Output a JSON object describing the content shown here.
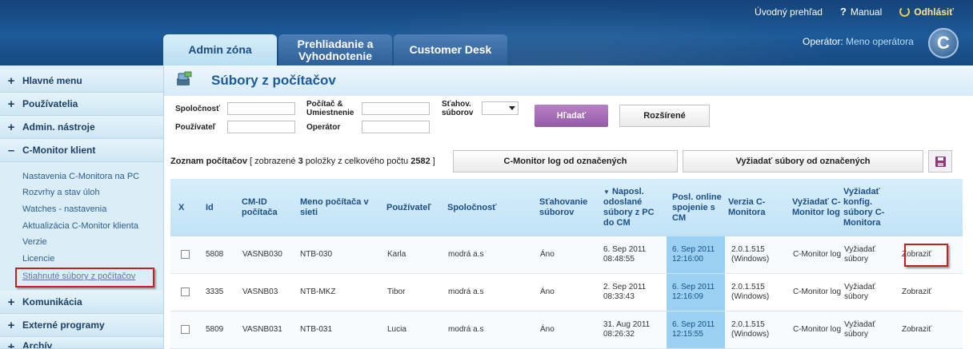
{
  "top_links": {
    "home": "Úvodný prehľad",
    "manual": "Manual",
    "logout": "Odhlásiť"
  },
  "tabs": [
    {
      "label": "Admin zóna",
      "active": true
    },
    {
      "label": "Prehliadanie a Vyhodnotenie",
      "active": false
    },
    {
      "label": "Customer Desk",
      "active": false
    }
  ],
  "operator": {
    "label": "Operátor:",
    "name": "Meno operátora"
  },
  "logo": {
    "letter": "C"
  },
  "sidebar": {
    "items": [
      {
        "sign": "+",
        "label": "Hlavné menu"
      },
      {
        "sign": "+",
        "label": "Používatelia"
      },
      {
        "sign": "+",
        "label": "Admin. nástroje"
      },
      {
        "sign": "–",
        "label": "C-Monitor klient"
      },
      {
        "sign": "+",
        "label": "Komunikácia"
      },
      {
        "sign": "+",
        "label": "Externé programy"
      },
      {
        "sign": "+",
        "label": "Archív"
      }
    ],
    "subitems": [
      "Nastavenia C-Monitora na PC",
      "Rozvrhy a stav úloh",
      "Watches - nastavenia",
      "Aktualizácia C-Monitor klienta",
      "Verzie",
      "Licencie",
      "Stiahnuté súbory z počítačov"
    ]
  },
  "page_title": "Súbory z počítačov",
  "filters": {
    "company_label": "Spoločnosť",
    "computer_label": "Počítač & Umiestnenie",
    "downloads_label": "Sťahov. súborov",
    "user_label": "Používateľ",
    "operator_label": "Operátor",
    "search_button": "Hľadať",
    "advanced_button": "Rozšírené"
  },
  "list": {
    "title": "Zoznam počítačov",
    "summary_prefix": "[ zobrazené",
    "shown": "3",
    "summary_mid": "položky z celkového počtu",
    "total": "2582",
    "summary_suffix": "]",
    "btn_log": "C-Monitor log od označených",
    "btn_request": "Vyžiadať súbory od označených"
  },
  "table": {
    "headers": [
      "X",
      "Id",
      "CM-ID počítača",
      "Meno počítača v sieti",
      "Používateľ",
      "Spoločnosť",
      "Sťahovanie súborov",
      "Naposl. odoslané súbory z PC do CM",
      "Posl. online spojenie s CM",
      "Verzia C-Monitora",
      "Vyžiadať C-Monitor log",
      "Vyžiadať konfig. súbory C-Monitora",
      ""
    ],
    "sort_indicator": "▼",
    "rows": [
      {
        "id": "5808",
        "cmid": "VASNB030",
        "name": "NTB-030",
        "user": "Karla",
        "company": "modrá a.s",
        "download": "Áno",
        "last_sent": "6. Sep 2011 08:48:55",
        "last_online": "6. Sep 2011 12:16:00",
        "version": "2.0.1.515 (Windows)",
        "log": "C-Monitor log",
        "request": "Vyžiadať súbory",
        "show": "Zobraziť"
      },
      {
        "id": "3335",
        "cmid": "VASNB03",
        "name": "NTB-MKZ",
        "user": "Tibor",
        "company": "modrá a.s",
        "download": "Áno",
        "last_sent": "2. Sep 2011 08:33:43",
        "last_online": "6. Sep 2011 12:16:09",
        "version": "2.0.1.515 (Windows)",
        "log": "C-Monitor log",
        "request": "Vyžiadať súbory",
        "show": "Zobraziť"
      },
      {
        "id": "5809",
        "cmid": "VASNB031",
        "name": "NTB-031",
        "user": "Lucia",
        "company": "modrá a.s",
        "download": "Áno",
        "last_sent": "31. Aug 2011 08:26:32",
        "last_online": "6. Sep 2011 12:15:55",
        "version": "2.0.1.515 (Windows)",
        "log": "C-Monitor log",
        "request": "Vyžiadať súbory",
        "show": "Zobraziť"
      }
    ]
  },
  "colors": {
    "header_blue": "#1d5a98",
    "accent_purple": "#955aa8",
    "highlight_red": "#c32020",
    "online_cell": "#9bd2f3"
  }
}
